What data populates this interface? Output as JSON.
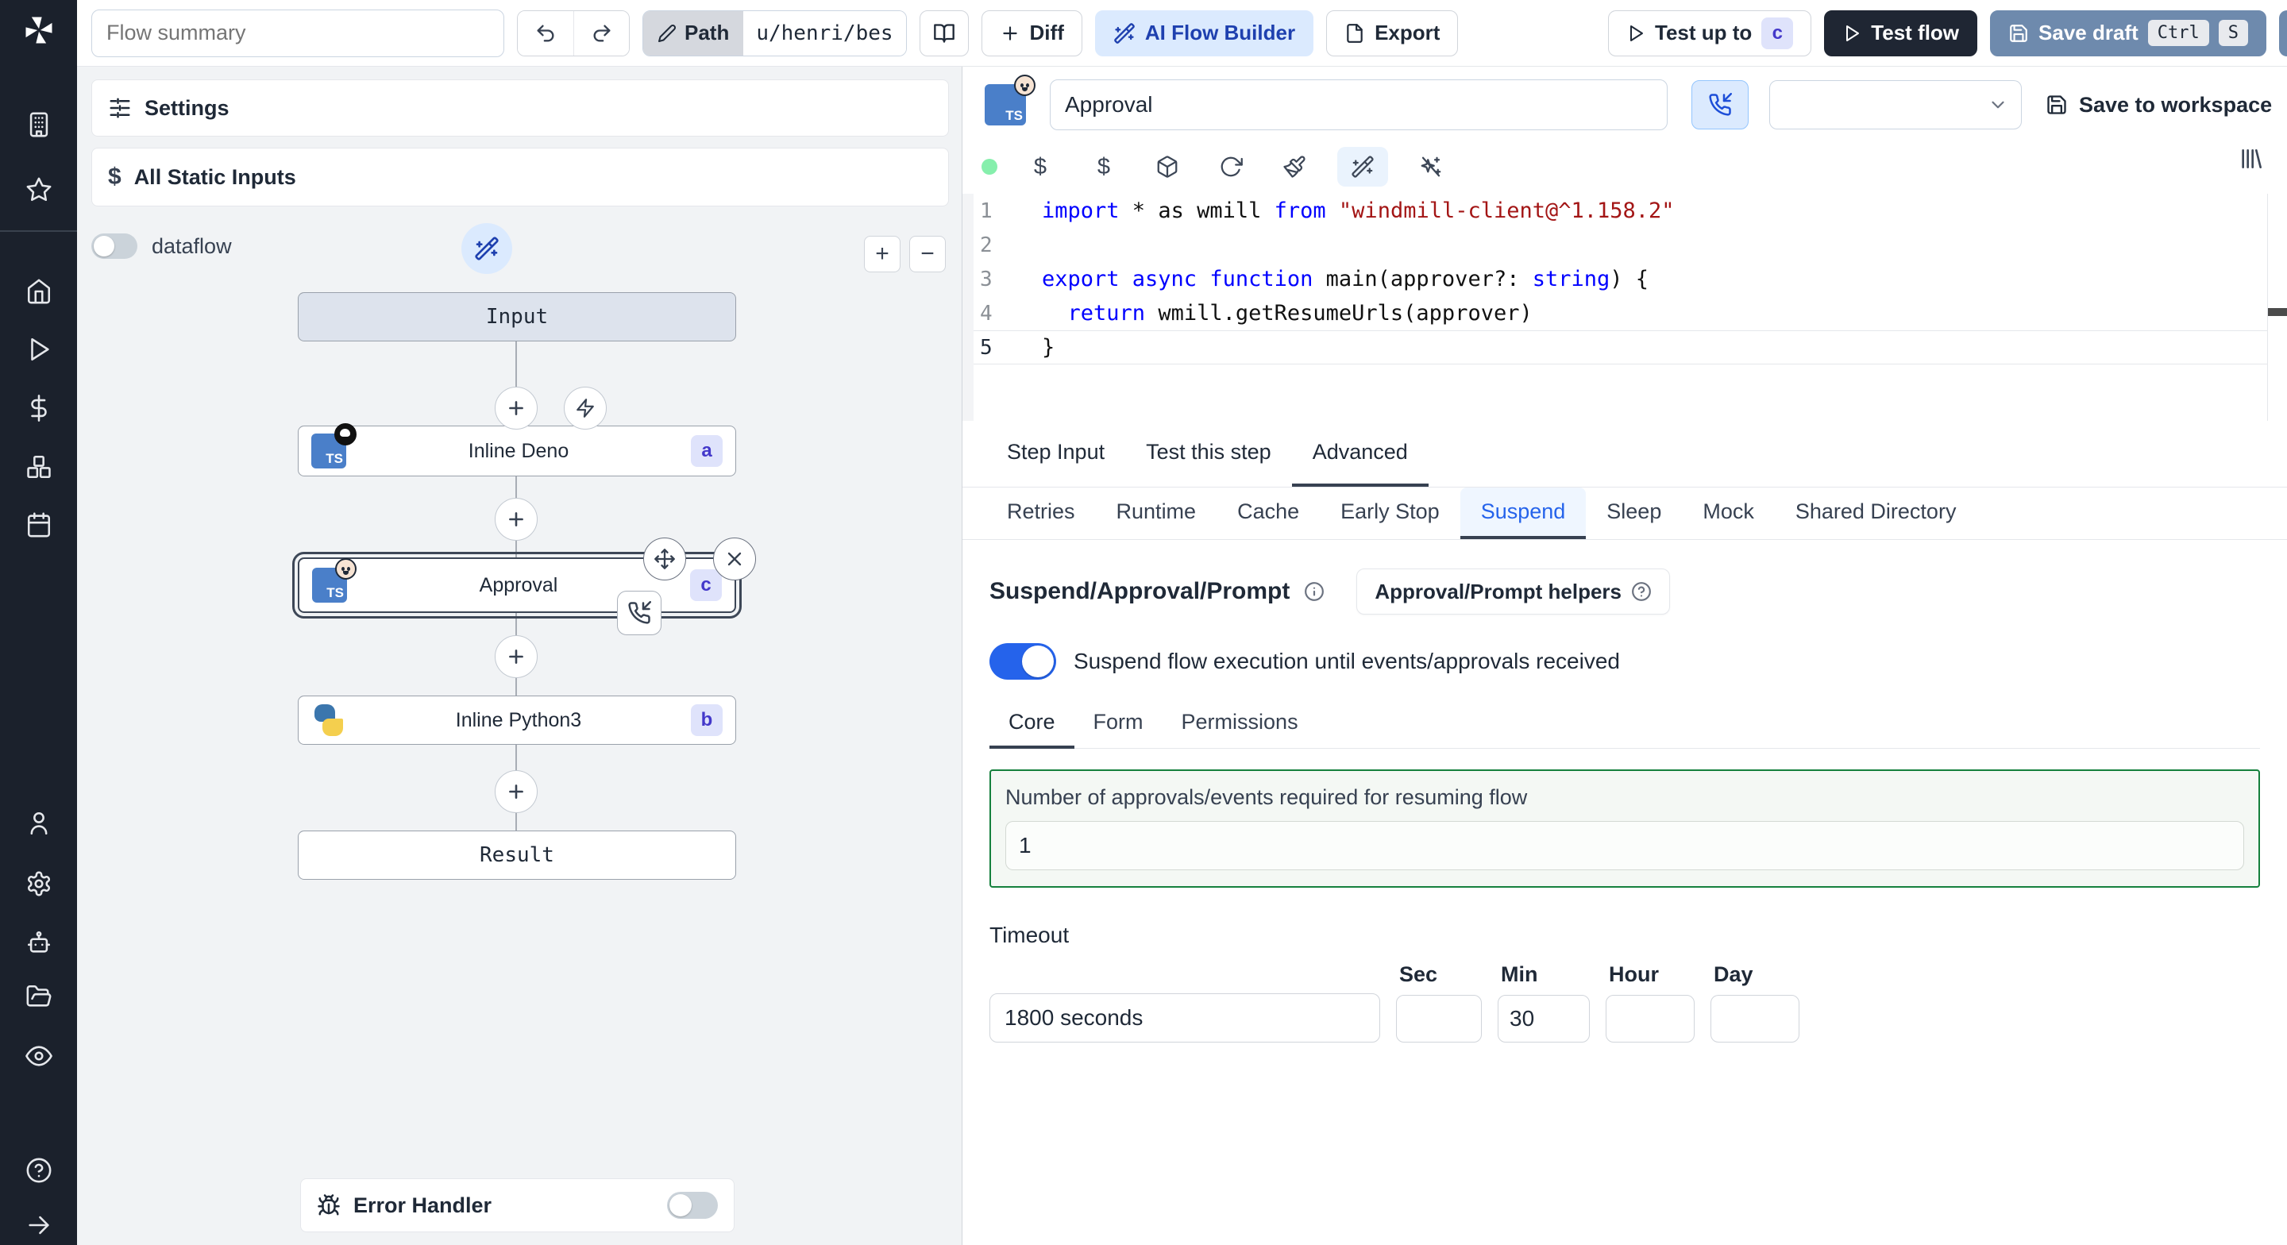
{
  "topbar": {
    "flow_summary": "Flow summary",
    "path_label": "Path",
    "path_value": "u/henri/bes",
    "diff_label": "Diff",
    "ai_flow_builder_label": "AI Flow Builder",
    "export_label": "Export",
    "test_up_to_label": "Test up to",
    "test_up_to_badge": "c",
    "test_flow_label": "Test flow",
    "save_draft_label": "Save draft",
    "kbd_ctrl": "Ctrl",
    "kbd_s": "S"
  },
  "sidebar": {
    "icons": [
      "windmill-logo",
      "building",
      "star",
      "home",
      "play",
      "dollar",
      "boxes",
      "calendar",
      "user",
      "settings",
      "robot",
      "folder-open",
      "eye",
      "help-circle",
      "arrow-right"
    ]
  },
  "flow_panel": {
    "settings_label": "Settings",
    "all_static_inputs_label": "All Static Inputs",
    "dataflow_label": "dataflow",
    "zoom_in": "+",
    "zoom_out": "−",
    "nodes": {
      "input_label": "Input",
      "deno_label": "Inline Deno",
      "deno_badge": "a",
      "approval_label": "Approval",
      "approval_badge": "c",
      "python_label": "Inline Python3",
      "python_badge": "b",
      "result_label": "Result"
    },
    "error_handler_label": "Error Handler"
  },
  "editor": {
    "step_name": "Approval",
    "save_to_workspace_label": "Save to workspace",
    "code": {
      "n1": "1",
      "n2": "2",
      "n3": "3",
      "n4": "4",
      "n5": "5",
      "l1": {
        "k1": "import",
        "p1": " * as wmill ",
        "k2": "from",
        "p2": " ",
        "s1": "\"windmill-client@^1.158.2\""
      },
      "l3": {
        "k1": "export async function",
        "p1": " main(approver?: ",
        "k2": "string",
        "p2": ") {"
      },
      "l4": {
        "ind": "  ",
        "k1": "return",
        "p1": " wmill.getResumeUrls(approver)"
      },
      "l5": {
        "p1": "}"
      }
    },
    "tabs": [
      "Step Input",
      "Test this step",
      "Advanced"
    ],
    "advanced_tabs": [
      "Retries",
      "Runtime",
      "Cache",
      "Early Stop",
      "Suspend",
      "Sleep",
      "Mock",
      "Shared Directory"
    ],
    "suspend": {
      "title": "Suspend/Approval/Prompt",
      "helpers_label": "Approval/Prompt helpers",
      "toggle_label": "Suspend flow execution until events/approvals received",
      "sub_tabs": [
        "Core",
        "Form",
        "Permissions"
      ],
      "approvals_label": "Number of approvals/events required for resuming flow",
      "approvals_value": "1",
      "timeout_label": "Timeout",
      "timeout_value": "1800 seconds",
      "unit_sec": "Sec",
      "unit_min": "Min",
      "unit_hour": "Hour",
      "unit_day": "Day",
      "min_value": "30"
    }
  },
  "colors": {
    "accent": "#2563eb",
    "suspend_green": "#15803d",
    "dark_button": "#1f2633",
    "save_draft_blue": "#6e8aad",
    "badge_bg": "#dfe3fb",
    "badge_text": "#4338ca"
  }
}
